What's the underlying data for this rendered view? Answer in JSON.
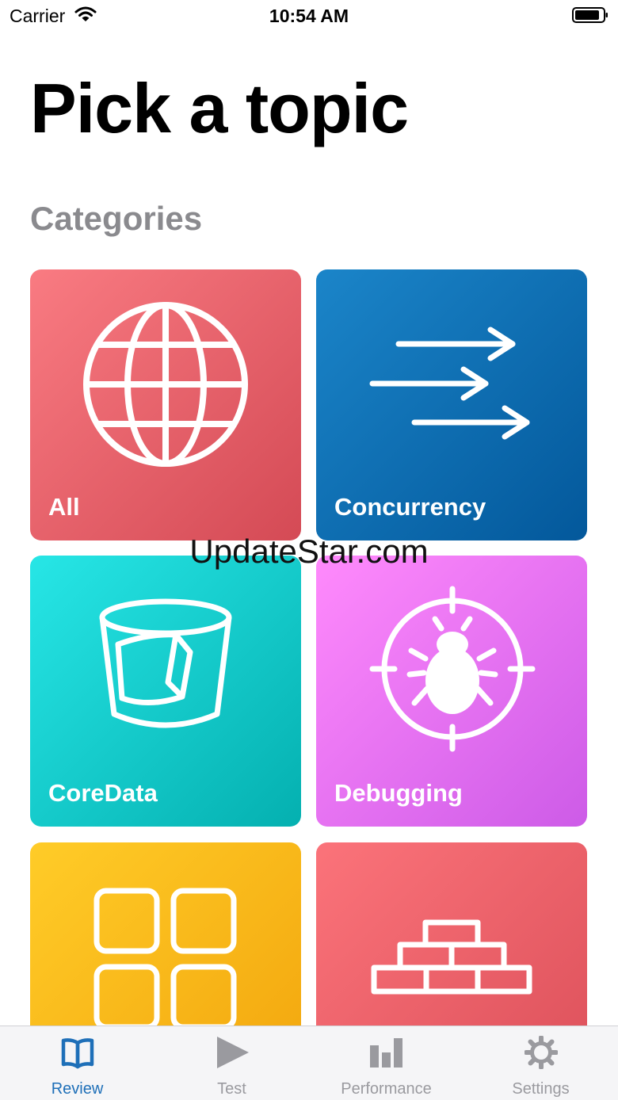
{
  "status_bar": {
    "carrier": "Carrier",
    "time": "10:54 AM"
  },
  "page": {
    "title": "Pick a topic",
    "section_heading": "Categories"
  },
  "categories": [
    {
      "label": "All",
      "icon": "globe-icon"
    },
    {
      "label": "Concurrency",
      "icon": "arrows-icon"
    },
    {
      "label": "CoreData",
      "icon": "database-icon"
    },
    {
      "label": "Debugging",
      "icon": "bug-target-icon"
    },
    {
      "label": "",
      "icon": "grid-icon"
    },
    {
      "label": "",
      "icon": "bricks-icon"
    }
  ],
  "watermark": "UpdateStar.com",
  "tab_bar": {
    "tabs": [
      {
        "label": "Review",
        "icon": "book-icon",
        "active": true
      },
      {
        "label": "Test",
        "icon": "play-icon",
        "active": false
      },
      {
        "label": "Performance",
        "icon": "bar-chart-icon",
        "active": false
      },
      {
        "label": "Settings",
        "icon": "gear-icon",
        "active": false
      }
    ]
  },
  "colors": {
    "tab_active": "#1e6fb8",
    "tab_inactive": "#9a9a9f",
    "all_tile": "#e8606a",
    "concurrency_tile": "#0a6fb5",
    "coredata_tile": "#12cccc",
    "debugging_tile": "#ea73f2",
    "grid_tile": "#fab81a",
    "bricks_tile": "#ea6068"
  }
}
